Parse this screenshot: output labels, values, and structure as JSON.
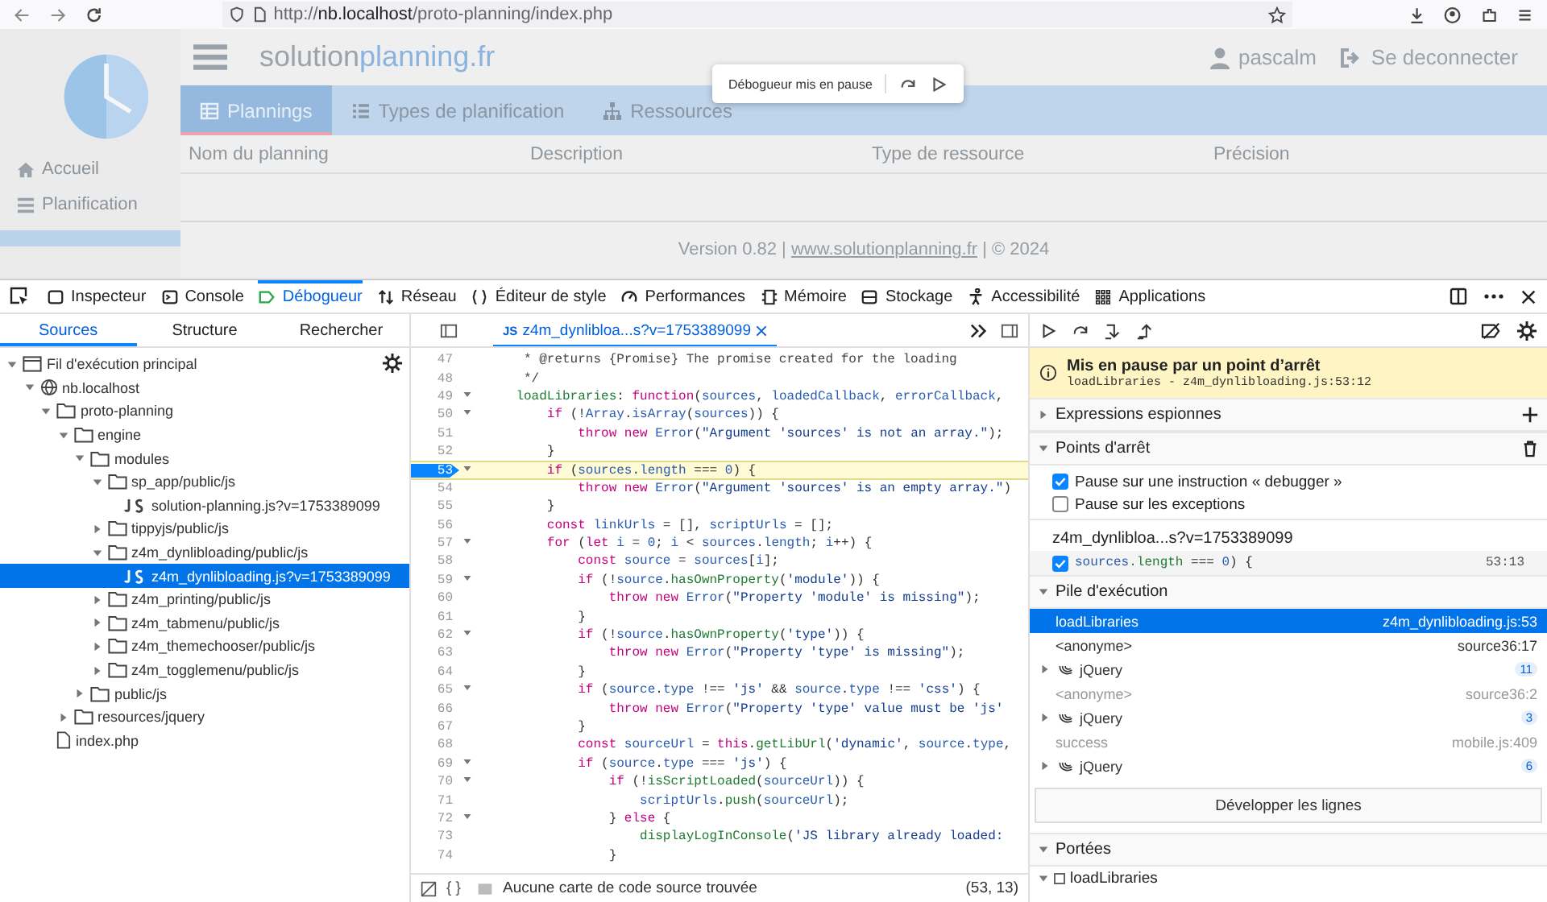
{
  "browser": {
    "url": "http://**nb.localhost**/proto-planning/index.php"
  },
  "page": {
    "brand": {
      "first": "solution",
      "second": "planning.fr"
    },
    "user": "pascalm",
    "logout": "Se deconnecter",
    "nav": [
      {
        "label": "Accueil",
        "kind": "home",
        "selected": false
      },
      {
        "label": "Planification",
        "kind": "list",
        "selected": false
      },
      {
        "selected": true
      }
    ],
    "tabs": [
      {
        "label": "Plannings",
        "kind": "grid",
        "selected": true
      },
      {
        "label": "Types de planification",
        "kind": "list",
        "selected": false
      },
      {
        "label": "Ressources",
        "kind": "tree",
        "selected": false
      }
    ],
    "columns": [
      "Nom du planning",
      "Description",
      "Type de ressource",
      "Précision"
    ],
    "footer": {
      "before": "Version 0.82 | ",
      "link": "www.solutionplanning.fr",
      "after": " | © 2024"
    },
    "pause_box": {
      "label": "Débogueur mis en pause"
    }
  },
  "devtools": {
    "tabs": [
      {
        "label": "Inspecteur",
        "kind": "inspector",
        "selected": false
      },
      {
        "label": "Console",
        "kind": "console",
        "selected": false
      },
      {
        "label": "Débogueur",
        "kind": "debugger",
        "selected": true
      },
      {
        "label": "Réseau",
        "kind": "network",
        "selected": false
      },
      {
        "label": "Éditeur de style",
        "kind": "style",
        "selected": false
      },
      {
        "label": "Performances",
        "kind": "performance",
        "selected": false
      },
      {
        "label": "Mémoire",
        "kind": "memory",
        "selected": false
      },
      {
        "label": "Stockage",
        "kind": "storage",
        "selected": false
      },
      {
        "label": "Accessibilité",
        "kind": "accessibility",
        "selected": false
      },
      {
        "label": "Applications",
        "kind": "applications",
        "selected": false
      }
    ],
    "side_tabs": [
      {
        "label": "Sources",
        "selected": true
      },
      {
        "label": "Structure",
        "selected": false
      },
      {
        "label": "Rechercher",
        "selected": false
      }
    ],
    "tree": [
      {
        "label": "Fil d'exécution principal",
        "kind": "thread",
        "expanded": true,
        "selected": false,
        "children": [
          {
            "label": "nb.localhost",
            "kind": "domain",
            "expanded": true,
            "selected": false,
            "children": [
              {
                "label": "proto-planning",
                "kind": "folder",
                "expanded": true,
                "selected": false,
                "children": [
                  {
                    "label": "engine",
                    "kind": "folder",
                    "expanded": true,
                    "selected": false,
                    "children": [
                      {
                        "label": "modules",
                        "kind": "folder",
                        "expanded": true,
                        "selected": false,
                        "children": [
                          {
                            "label": "sp_app/public/js",
                            "kind": "folder",
                            "expanded": true,
                            "selected": false,
                            "children": [
                              {
                                "label": "solution-planning.js?v=1753389099",
                                "kind": "js",
                                "selected": false
                              }
                            ]
                          },
                          {
                            "label": "tippyjs/public/js",
                            "kind": "folder",
                            "expanded": false,
                            "selected": false
                          },
                          {
                            "label": "z4m_dynlibloading/public/js",
                            "kind": "folder",
                            "expanded": true,
                            "selected": false,
                            "children": [
                              {
                                "label": "z4m_dynlibloading.js?v=1753389099",
                                "kind": "js",
                                "selected": true
                              }
                            ]
                          },
                          {
                            "label": "z4m_printing/public/js",
                            "kind": "folder",
                            "expanded": false,
                            "selected": false
                          },
                          {
                            "label": "z4m_tabmenu/public/js",
                            "kind": "folder",
                            "expanded": false,
                            "selected": false
                          },
                          {
                            "label": "z4m_themechooser/public/js",
                            "kind": "folder",
                            "expanded": false,
                            "selected": false
                          },
                          {
                            "label": "z4m_togglemenu/public/js",
                            "kind": "folder",
                            "expanded": false,
                            "selected": false
                          }
                        ]
                      },
                      {
                        "label": "public/js",
                        "kind": "folder",
                        "expanded": false,
                        "selected": false
                      }
                    ]
                  },
                  {
                    "label": "resources/jquery",
                    "kind": "folder",
                    "expanded": false,
                    "selected": false
                  }
                ]
              },
              {
                "label": "index.php",
                "kind": "file",
                "selected": false
              }
            ]
          }
        ]
      }
    ],
    "editor_tab": {
      "badge": "JS",
      "label": "z4m_dynlibloa...s?v=1753389099"
    },
    "code": [
      {
        "num": "47",
        "foldable": false,
        "paused": false,
        "tokens": [
          {
            "kind": "comment",
            "text": "     * @returns {Promise} The promise created for the loading"
          }
        ]
      },
      {
        "num": "48",
        "foldable": false,
        "paused": false,
        "tokens": [
          {
            "kind": "comment",
            "text": "     */"
          }
        ]
      },
      {
        "num": "49",
        "foldable": true,
        "paused": false,
        "tokens": [
          {
            "kind": "method",
            "text": "    loadLibraries"
          },
          {
            "kind": "plain",
            "text": ": "
          },
          {
            "kind": "keyword",
            "text": "function"
          },
          {
            "kind": "plain",
            "text": "("
          },
          {
            "kind": "variable",
            "text": "sources"
          },
          {
            "kind": "plain",
            "text": ", "
          },
          {
            "kind": "variable",
            "text": "loadedCallback"
          },
          {
            "kind": "plain",
            "text": ", "
          },
          {
            "kind": "variable",
            "text": "errorCallback"
          },
          {
            "kind": "plain",
            "text": ","
          }
        ]
      },
      {
        "num": "50",
        "foldable": true,
        "paused": false,
        "tokens": [
          {
            "kind": "keyword",
            "text": "        if"
          },
          {
            "kind": "plain",
            "text": " (!"
          },
          {
            "kind": "variable",
            "text": "Array"
          },
          {
            "kind": "plain",
            "text": "."
          },
          {
            "kind": "variable",
            "text": "isArray"
          },
          {
            "kind": "plain",
            "text": "("
          },
          {
            "kind": "variable",
            "text": "sources"
          },
          {
            "kind": "plain",
            "text": ")) {"
          }
        ]
      },
      {
        "num": "51",
        "foldable": false,
        "paused": false,
        "tokens": [
          {
            "kind": "keyword",
            "text": "            throw new "
          },
          {
            "kind": "variable",
            "text": "Error"
          },
          {
            "kind": "plain",
            "text": "("
          },
          {
            "kind": "string",
            "text": "\"Argument 'sources' is not an array.\""
          },
          {
            "kind": "plain",
            "text": ");"
          }
        ]
      },
      {
        "num": "52",
        "foldable": false,
        "paused": false,
        "tokens": [
          {
            "kind": "plain",
            "text": "        }"
          }
        ]
      },
      {
        "num": "53",
        "foldable": true,
        "paused": true,
        "tokens": [
          {
            "kind": "keyword",
            "text": "        if"
          },
          {
            "kind": "plain",
            "text": " ("
          },
          {
            "kind": "variable",
            "text": "sources"
          },
          {
            "kind": "plain",
            "text": "."
          },
          {
            "kind": "variable",
            "text": "length"
          },
          {
            "kind": "plain",
            "text": " === "
          },
          {
            "kind": "number",
            "text": "0"
          },
          {
            "kind": "plain",
            "text": ") {"
          }
        ]
      },
      {
        "num": "54",
        "foldable": false,
        "paused": false,
        "tokens": [
          {
            "kind": "keyword",
            "text": "            throw new "
          },
          {
            "kind": "variable",
            "text": "Error"
          },
          {
            "kind": "plain",
            "text": "("
          },
          {
            "kind": "string",
            "text": "\"Argument 'sources' is an empty array.\""
          },
          {
            "kind": "plain",
            "text": ")"
          }
        ]
      },
      {
        "num": "55",
        "foldable": false,
        "paused": false,
        "tokens": [
          {
            "kind": "plain",
            "text": "        }"
          }
        ]
      },
      {
        "num": "56",
        "foldable": false,
        "paused": false,
        "tokens": [
          {
            "kind": "keyword",
            "text": "        const "
          },
          {
            "kind": "variable",
            "text": "linkUrls"
          },
          {
            "kind": "plain",
            "text": " = [], "
          },
          {
            "kind": "variable",
            "text": "scriptUrls"
          },
          {
            "kind": "plain",
            "text": " = [];"
          }
        ]
      },
      {
        "num": "57",
        "foldable": true,
        "paused": false,
        "tokens": [
          {
            "kind": "keyword",
            "text": "        for"
          },
          {
            "kind": "plain",
            "text": " ("
          },
          {
            "kind": "keyword",
            "text": "let "
          },
          {
            "kind": "variable",
            "text": "i"
          },
          {
            "kind": "plain",
            "text": " = "
          },
          {
            "kind": "number",
            "text": "0"
          },
          {
            "kind": "plain",
            "text": "; "
          },
          {
            "kind": "variable",
            "text": "i"
          },
          {
            "kind": "plain",
            "text": " < "
          },
          {
            "kind": "variable",
            "text": "sources"
          },
          {
            "kind": "plain",
            "text": "."
          },
          {
            "kind": "variable",
            "text": "length"
          },
          {
            "kind": "plain",
            "text": "; "
          },
          {
            "kind": "variable",
            "text": "i"
          },
          {
            "kind": "plain",
            "text": "++) {"
          }
        ]
      },
      {
        "num": "58",
        "foldable": false,
        "paused": false,
        "tokens": [
          {
            "kind": "keyword",
            "text": "            const "
          },
          {
            "kind": "variable",
            "text": "source"
          },
          {
            "kind": "plain",
            "text": " = "
          },
          {
            "kind": "variable",
            "text": "sources"
          },
          {
            "kind": "plain",
            "text": "["
          },
          {
            "kind": "variable",
            "text": "i"
          },
          {
            "kind": "plain",
            "text": "];"
          }
        ]
      },
      {
        "num": "59",
        "foldable": true,
        "paused": false,
        "tokens": [
          {
            "kind": "keyword",
            "text": "            if"
          },
          {
            "kind": "plain",
            "text": " (!"
          },
          {
            "kind": "variable",
            "text": "source"
          },
          {
            "kind": "plain",
            "text": "."
          },
          {
            "kind": "method",
            "text": "hasOwnProperty"
          },
          {
            "kind": "plain",
            "text": "("
          },
          {
            "kind": "string",
            "text": "'module'"
          },
          {
            "kind": "plain",
            "text": ")) {"
          }
        ]
      },
      {
        "num": "60",
        "foldable": false,
        "paused": false,
        "tokens": [
          {
            "kind": "keyword",
            "text": "                throw new "
          },
          {
            "kind": "variable",
            "text": "Error"
          },
          {
            "kind": "plain",
            "text": "("
          },
          {
            "kind": "string",
            "text": "\"Property 'module' is missing\""
          },
          {
            "kind": "plain",
            "text": ");"
          }
        ]
      },
      {
        "num": "61",
        "foldable": false,
        "paused": false,
        "tokens": [
          {
            "kind": "plain",
            "text": "            }"
          }
        ]
      },
      {
        "num": "62",
        "foldable": true,
        "paused": false,
        "tokens": [
          {
            "kind": "keyword",
            "text": "            if"
          },
          {
            "kind": "plain",
            "text": " (!"
          },
          {
            "kind": "variable",
            "text": "source"
          },
          {
            "kind": "plain",
            "text": "."
          },
          {
            "kind": "method",
            "text": "hasOwnProperty"
          },
          {
            "kind": "plain",
            "text": "("
          },
          {
            "kind": "string",
            "text": "'type'"
          },
          {
            "kind": "plain",
            "text": ")) {"
          }
        ]
      },
      {
        "num": "63",
        "foldable": false,
        "paused": false,
        "tokens": [
          {
            "kind": "keyword",
            "text": "                throw new "
          },
          {
            "kind": "variable",
            "text": "Error"
          },
          {
            "kind": "plain",
            "text": "("
          },
          {
            "kind": "string",
            "text": "\"Property 'type' is missing\""
          },
          {
            "kind": "plain",
            "text": ");"
          }
        ]
      },
      {
        "num": "64",
        "foldable": false,
        "paused": false,
        "tokens": [
          {
            "kind": "plain",
            "text": "            }"
          }
        ]
      },
      {
        "num": "65",
        "foldable": true,
        "paused": false,
        "tokens": [
          {
            "kind": "keyword",
            "text": "            if"
          },
          {
            "kind": "plain",
            "text": " ("
          },
          {
            "kind": "variable",
            "text": "source"
          },
          {
            "kind": "plain",
            "text": "."
          },
          {
            "kind": "variable",
            "text": "type"
          },
          {
            "kind": "plain",
            "text": " !== "
          },
          {
            "kind": "string",
            "text": "'js'"
          },
          {
            "kind": "plain",
            "text": " && "
          },
          {
            "kind": "variable",
            "text": "source"
          },
          {
            "kind": "plain",
            "text": "."
          },
          {
            "kind": "variable",
            "text": "type"
          },
          {
            "kind": "plain",
            "text": " !== "
          },
          {
            "kind": "string",
            "text": "'css'"
          },
          {
            "kind": "plain",
            "text": ") {"
          }
        ]
      },
      {
        "num": "66",
        "foldable": false,
        "paused": false,
        "tokens": [
          {
            "kind": "keyword",
            "text": "                throw new "
          },
          {
            "kind": "variable",
            "text": "Error"
          },
          {
            "kind": "plain",
            "text": "("
          },
          {
            "kind": "string",
            "text": "\"Property 'type' value must be 'js'"
          }
        ]
      },
      {
        "num": "67",
        "foldable": false,
        "paused": false,
        "tokens": [
          {
            "kind": "plain",
            "text": "            }"
          }
        ]
      },
      {
        "num": "68",
        "foldable": false,
        "paused": false,
        "tokens": [
          {
            "kind": "keyword",
            "text": "            const "
          },
          {
            "kind": "variable",
            "text": "sourceUrl"
          },
          {
            "kind": "plain",
            "text": " = "
          },
          {
            "kind": "keyword",
            "text": "this"
          },
          {
            "kind": "plain",
            "text": "."
          },
          {
            "kind": "method",
            "text": "getLibUrl"
          },
          {
            "kind": "plain",
            "text": "("
          },
          {
            "kind": "string",
            "text": "'dynamic'"
          },
          {
            "kind": "plain",
            "text": ", "
          },
          {
            "kind": "variable",
            "text": "source"
          },
          {
            "kind": "plain",
            "text": "."
          },
          {
            "kind": "variable",
            "text": "type"
          },
          {
            "kind": "plain",
            "text": ","
          }
        ]
      },
      {
        "num": "69",
        "foldable": true,
        "paused": false,
        "tokens": [
          {
            "kind": "keyword",
            "text": "            if"
          },
          {
            "kind": "plain",
            "text": " ("
          },
          {
            "kind": "variable",
            "text": "source"
          },
          {
            "kind": "plain",
            "text": "."
          },
          {
            "kind": "variable",
            "text": "type"
          },
          {
            "kind": "plain",
            "text": " === "
          },
          {
            "kind": "string",
            "text": "'js'"
          },
          {
            "kind": "plain",
            "text": ") {"
          }
        ]
      },
      {
        "num": "70",
        "foldable": true,
        "paused": false,
        "tokens": [
          {
            "kind": "keyword",
            "text": "                if"
          },
          {
            "kind": "plain",
            "text": " (!"
          },
          {
            "kind": "method",
            "text": "isScriptLoaded"
          },
          {
            "kind": "plain",
            "text": "("
          },
          {
            "kind": "variable",
            "text": "sourceUrl"
          },
          {
            "kind": "plain",
            "text": ")) {"
          }
        ]
      },
      {
        "num": "71",
        "foldable": false,
        "paused": false,
        "tokens": [
          {
            "kind": "variable",
            "text": "                    scriptUrls"
          },
          {
            "kind": "plain",
            "text": "."
          },
          {
            "kind": "method",
            "text": "push"
          },
          {
            "kind": "plain",
            "text": "("
          },
          {
            "kind": "variable",
            "text": "sourceUrl"
          },
          {
            "kind": "plain",
            "text": ");"
          }
        ]
      },
      {
        "num": "72",
        "foldable": true,
        "paused": false,
        "tokens": [
          {
            "kind": "plain",
            "text": "                } "
          },
          {
            "kind": "keyword",
            "text": "else"
          },
          {
            "kind": "plain",
            "text": " {"
          }
        ]
      },
      {
        "num": "73",
        "foldable": false,
        "paused": false,
        "tokens": [
          {
            "kind": "method",
            "text": "                    displayLogInConsole"
          },
          {
            "kind": "plain",
            "text": "("
          },
          {
            "kind": "string",
            "text": "'JS library already loaded:"
          }
        ]
      },
      {
        "num": "74",
        "foldable": false,
        "paused": false,
        "tokens": [
          {
            "kind": "plain",
            "text": "                }"
          }
        ]
      }
    ],
    "status": {
      "format": "{ }",
      "message": "Aucune carte de code source trouvée",
      "position": "(53, 13)"
    },
    "pause": {
      "title": "Mis en pause par un point d’arrêt",
      "location": "loadLibraries - z4m_dynlibloading.js:53:12"
    },
    "watch": {
      "title": "Expressions espionnes",
      "expanded": false
    },
    "breakpoints": {
      "title": "Points d'arrêt",
      "expanded": true,
      "options": [
        {
          "label": "Pause sur une instruction « debugger »",
          "checked": true
        },
        {
          "label": "Pause sur les exceptions",
          "checked": false
        }
      ],
      "file": "z4m_dynlibloa...s?v=1753389099",
      "items": [
        {
          "checked": true,
          "tokens": [
            {
              "kind": "variable",
              "text": "sources"
            },
            {
              "kind": "method",
              "text": ".length"
            },
            {
              "kind": "plain",
              "text": " === "
            },
            {
              "kind": "number",
              "text": "0"
            },
            {
              "kind": "plain",
              "text": ") {"
            }
          ],
          "line": "53:13"
        }
      ]
    },
    "callstack": {
      "title": "Pile d'exécution",
      "expanded": true,
      "frames": [
        {
          "kind": "frame",
          "name": "loadLibraries",
          "location": "z4m_dynlibloading.js:53",
          "selected": true,
          "dim": false
        },
        {
          "kind": "frame",
          "name": "<anonyme>",
          "location": "source36:17",
          "selected": false,
          "dim": false
        },
        {
          "kind": "group",
          "name": "jQuery",
          "count": "11",
          "expanded": false,
          "selected": false
        },
        {
          "kind": "frame",
          "name": "<anonyme>",
          "location": "source36:2",
          "selected": false,
          "dim": true
        },
        {
          "kind": "group",
          "name": "jQuery",
          "count": "3",
          "expanded": false,
          "selected": false
        },
        {
          "kind": "frame",
          "name": "success",
          "location": "mobile.js:409",
          "selected": false,
          "dim": true
        },
        {
          "kind": "group",
          "name": "jQuery",
          "count": "6",
          "expanded": false,
          "selected": false
        }
      ]
    },
    "expand_button": "Développer les lignes",
    "scopes": {
      "title": "Portées",
      "expanded": true,
      "items": [
        {
          "name": "loadLibraries",
          "expanded": true
        }
      ]
    }
  }
}
